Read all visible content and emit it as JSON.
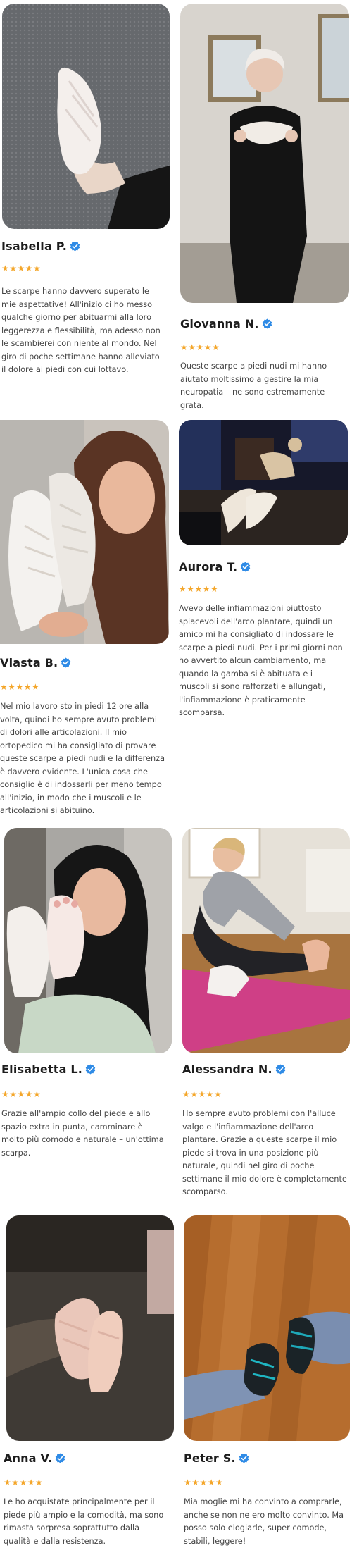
{
  "colors": {
    "star": "#f4a62a",
    "verified": "#2f8be6",
    "text": "#444444",
    "name": "#1d1d1d"
  },
  "rating_stars": "★★★★★",
  "reviews": [
    {
      "name": "Isabella P.",
      "stars": "★★★★★",
      "verified_icon": "verified-badge-icon",
      "text": "Le scarpe hanno davvero superato le mie aspettative! All'inizio ci ho messo qualche giorno per abituarmi alla loro leggerezza e flessibilità, ma adesso non le scambierei con niente al mondo. Nel giro di poche settimane hanno alleviato il dolore ai piedi con cui lottavo."
    },
    {
      "name": "Giovanna N.",
      "stars": "★★★★★",
      "verified_icon": "verified-badge-icon",
      "text": "Queste scarpe a piedi nudi mi hanno aiutato moltissimo a gestire la mia neuropatia – ne sono estremamente grata."
    },
    {
      "name": "Vlasta B.",
      "stars": "★★★★★",
      "verified_icon": "verified-badge-icon",
      "text": "Nel mio lavoro sto in piedi 12 ore alla volta, quindi ho sempre avuto problemi di dolori alle articolazioni. Il mio ortopedico mi ha consigliato di provare queste scarpe a piedi nudi e la differenza è davvero evidente. L'unica cosa che consiglio è di indossarli per meno tempo all'inizio, in modo che i muscoli e le articolazioni si abituino."
    },
    {
      "name": "Aurora T.",
      "stars": "★★★★★",
      "verified_icon": "verified-badge-icon",
      "text": "Avevo delle infiammazioni piuttosto spiacevoli dell'arco plantare, quindi un amico mi ha consigliato di indossare le scarpe a piedi nudi. Per i primi giorni non ho avvertito alcun cambiamento, ma quando la gamba si è abituata e i muscoli si sono rafforzati e allungati, l'infiammazione è praticamente scomparsa."
    },
    {
      "name": "Elisabetta L.",
      "stars": "★★★★★",
      "verified_icon": "verified-badge-icon",
      "text": "Grazie all'ampio collo del piede e allo spazio extra in punta, camminare è molto più comodo e naturale – un'ottima scarpa."
    },
    {
      "name": "Alessandra N.",
      "stars": "★★★★★",
      "verified_icon": "verified-badge-icon",
      "text": "Ho sempre avuto problemi con l'alluce valgo e l'infiammazione dell'arco plantare. Grazie a queste scarpe il mio piede si trova in una posizione più naturale, quindi nel giro di poche settimane il mio dolore è completamente scomparso."
    },
    {
      "name": "Anna V.",
      "stars": "★★★★★",
      "verified_icon": "verified-badge-icon",
      "text": "Le ho acquistate principalmente per il piede più ampio e la comodità, ma sono rimasta sorpresa soprattutto dalla qualità e dalla resistenza."
    },
    {
      "name": "Peter S.",
      "stars": "★★★★★",
      "verified_icon": "verified-badge-icon",
      "text": "Mia moglie mi ha convinto a comprarle, anche se non ne ero molto convinto. Ma posso solo elogiarle, super comode, stabili, leggere!"
    }
  ]
}
